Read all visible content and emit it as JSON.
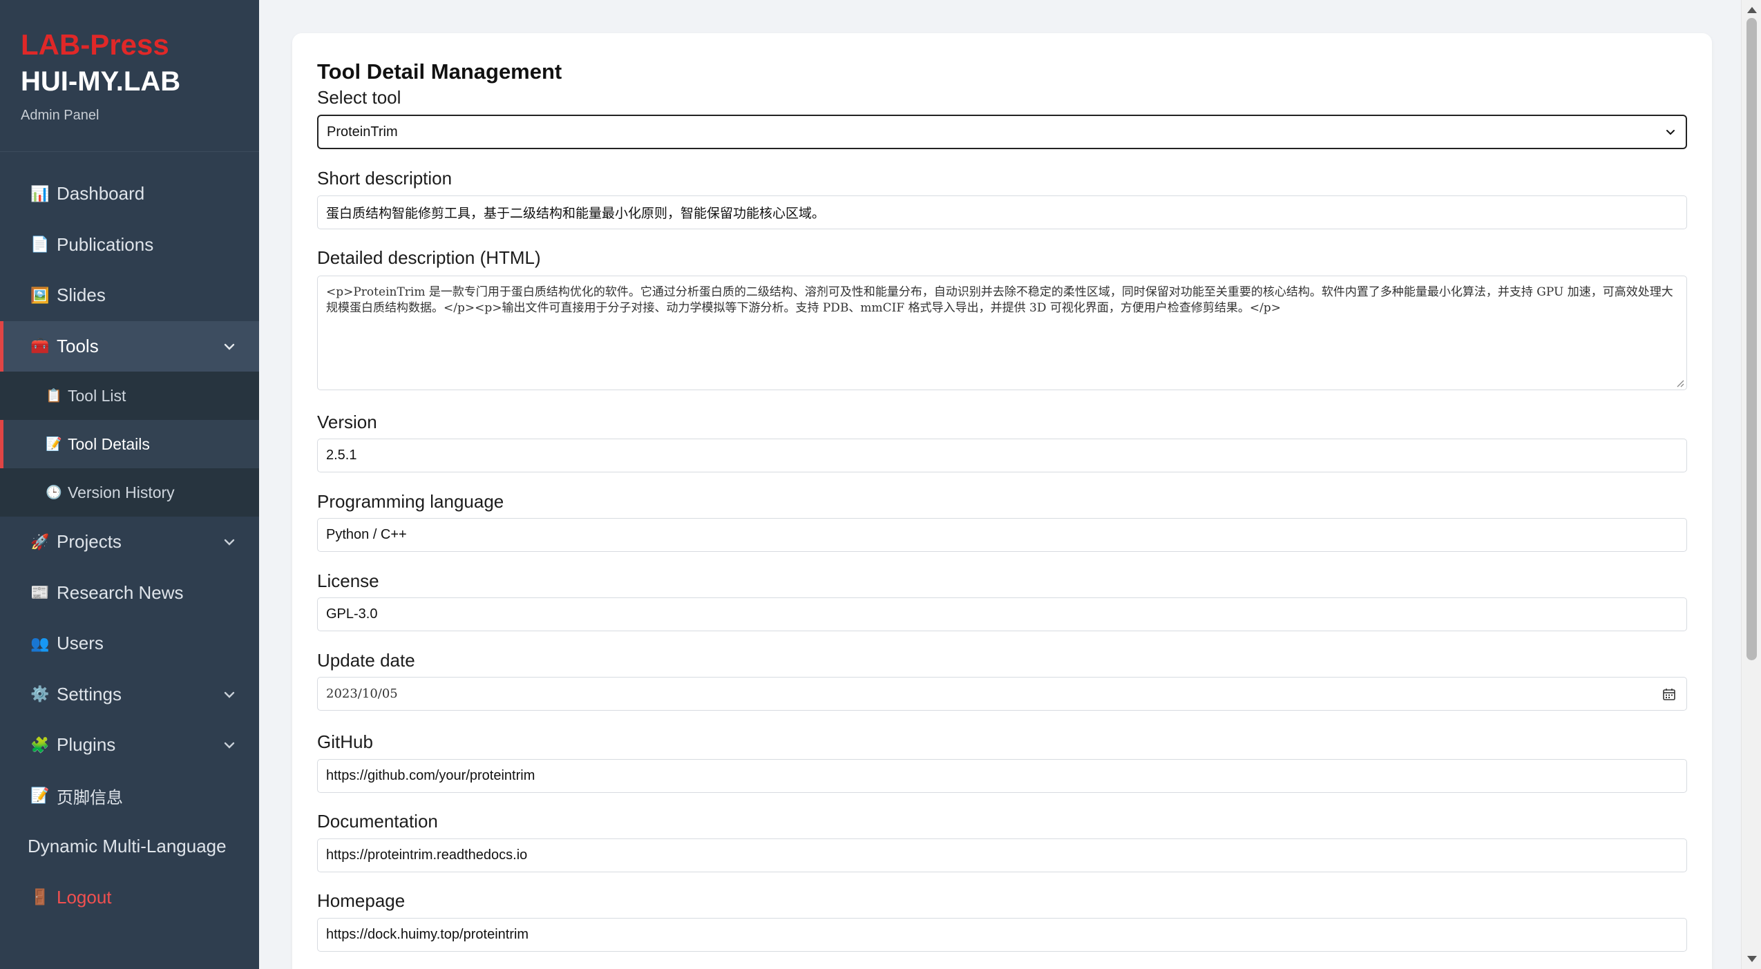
{
  "brand": {
    "lab_press": "LAB-Press",
    "name": "HUI-MY.LAB",
    "subtitle": "Admin Panel"
  },
  "sidebar": {
    "items": [
      {
        "label": "Dashboard",
        "icon": "📊"
      },
      {
        "label": "Publications",
        "icon": "📄"
      },
      {
        "label": "Slides",
        "icon": "🖼️"
      },
      {
        "label": "Tools",
        "icon": "🧰"
      },
      {
        "label": "Tool List",
        "icon": "📋"
      },
      {
        "label": "Tool Details",
        "icon": "📝"
      },
      {
        "label": "Version History",
        "icon": "🕒"
      },
      {
        "label": "Projects",
        "icon": "🚀"
      },
      {
        "label": "Research News",
        "icon": "📰"
      },
      {
        "label": "Users",
        "icon": "👥"
      },
      {
        "label": "Settings",
        "icon": "⚙️"
      },
      {
        "label": "Plugins",
        "icon": "🧩"
      },
      {
        "label": "页脚信息",
        "icon": "📝"
      },
      {
        "label": "Dynamic Multi-Language",
        "icon": ""
      },
      {
        "label": "Logout",
        "icon": "🚪"
      }
    ]
  },
  "main": {
    "title": "Tool Detail Management",
    "select_tool": {
      "label": "Select tool",
      "value": "ProteinTrim"
    },
    "short_description": {
      "label": "Short description",
      "value": "蛋白质结构智能修剪工具，基于二级结构和能量最小化原则，智能保留功能核心区域。"
    },
    "detailed_description": {
      "label": "Detailed description (HTML)",
      "value": "<p>ProteinTrim 是一款专门用于蛋白质结构优化的软件。它通过分析蛋白质的二级结构、溶剂可及性和能量分布，自动识别并去除不稳定的柔性区域，同时保留对功能至关重要的核心结构。软件内置了多种能量最小化算法，并支持 GPU 加速，可高效处理大规模蛋白质结构数据。</p><p>输出文件可直接用于分子对接、动力学模拟等下游分析。支持 PDB、mmCIF 格式导入导出，并提供 3D 可视化界面，方便用户检查修剪结果。</p>"
    },
    "version": {
      "label": "Version",
      "value": "2.5.1"
    },
    "language": {
      "label": "Programming language",
      "value": "Python / C++"
    },
    "license": {
      "label": "License",
      "value": "GPL-3.0"
    },
    "update_date": {
      "label": "Update date",
      "value": "2023/10/05"
    },
    "github": {
      "label": "GitHub",
      "value": "https://github.com/your/proteintrim"
    },
    "documentation": {
      "label": "Documentation",
      "value": "https://proteintrim.readthedocs.io"
    },
    "homepage": {
      "label": "Homepage",
      "value": "https://dock.huimy.top/proteintrim"
    }
  },
  "colors": {
    "sidebar_bg": "#2f3e4f",
    "accent_red": "#e02828",
    "active_border": "#e04545"
  }
}
